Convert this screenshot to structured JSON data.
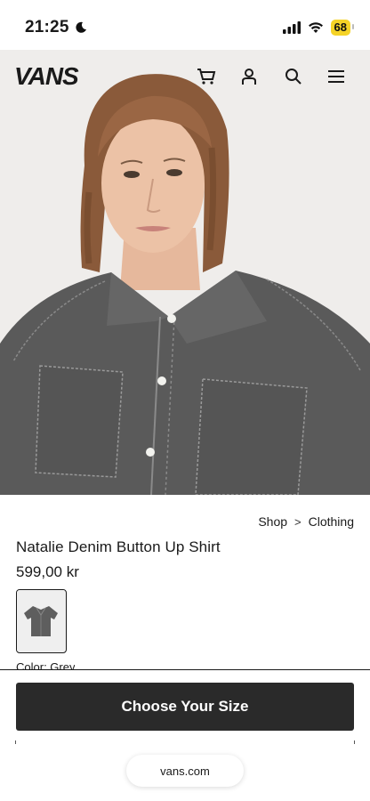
{
  "status_bar": {
    "time": "21:25",
    "battery": "68",
    "icons": [
      "moon-icon",
      "signal-icon",
      "wifi-icon",
      "battery-icon"
    ]
  },
  "header": {
    "logo": "VANS",
    "icons": [
      "cart-icon",
      "account-icon",
      "search-icon",
      "menu-icon"
    ]
  },
  "breadcrumb": {
    "items": [
      "Shop",
      "Clothing"
    ],
    "separator": ">"
  },
  "product": {
    "title": "Natalie Denim Button Up Shirt",
    "price": "599,00 kr",
    "color_label": "Color: Grey",
    "swatch_color": "#5e5e5e"
  },
  "actions": {
    "choose_size": "Choose Your Size"
  },
  "browser": {
    "url": "vans.com"
  },
  "colors": {
    "button_bg": "#2a2a2a",
    "battery": "#f5d327",
    "shirt": "#5a5a5a"
  }
}
